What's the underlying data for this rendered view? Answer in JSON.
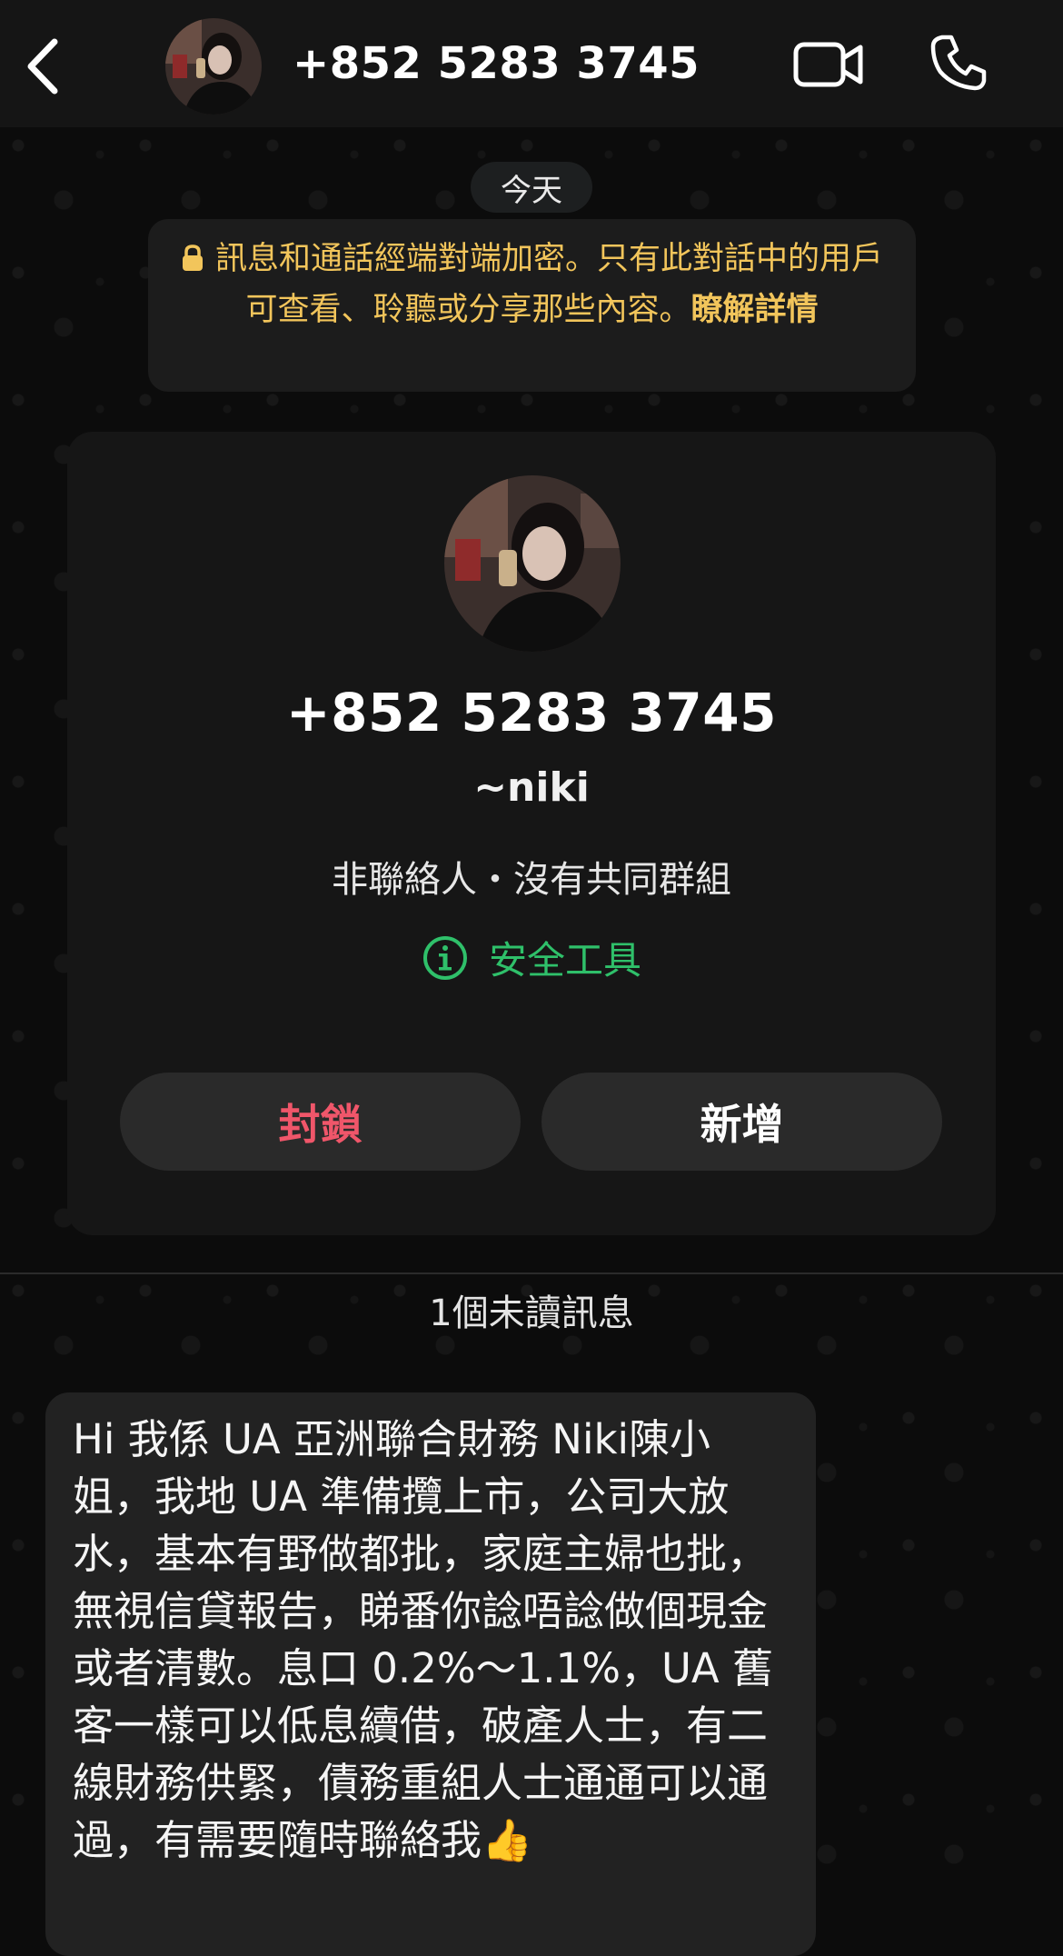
{
  "header": {
    "title": "+852 5283 3745",
    "back_icon": "chevron-left-icon",
    "video_icon": "video-camera-icon",
    "call_icon": "phone-icon"
  },
  "chat": {
    "date_label": "今天",
    "encryption_notice": "訊息和通話經端對端加密。只有此對話中的用戶可查看、聆聽或分享那些內容。",
    "encryption_link": "瞭解詳情",
    "notice_color": "#f2c55b"
  },
  "contact_card": {
    "phone": "+852 5283 3745",
    "nickname": "~niki",
    "status": "非聯絡人・沒有共同群組",
    "safety_tools_label": "安全工具",
    "safety_color": "#2fc06a",
    "block_label": "封鎖",
    "block_color": "#f0566a",
    "add_label": "新增"
  },
  "unread": {
    "label": "1個未讀訊息"
  },
  "message": {
    "text": "Hi 我係 UA 亞洲聯合財務 Niki陳小姐，我地 UA 準備攬上市，公司大放水，基本有野做都批，家庭主婦也批，無視信貸報告，睇番你諗唔諗做個現金或者清數。息口 0.2%～1.1%，UA 舊客一樣可以低息續借，破產人士，有二線財務供緊，債務重組人士通通可以通過，有需要隨時聯絡我👍"
  }
}
